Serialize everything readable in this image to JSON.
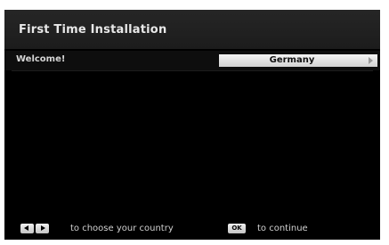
{
  "header": {
    "title": "First Time Installation"
  },
  "settings_row": {
    "label": "Welcome!",
    "country_value": "Germany"
  },
  "footer": {
    "ok_key_label": "OK",
    "choose_hint": "to choose your country",
    "continue_hint": "to continue"
  },
  "colors": {
    "background": "#000000",
    "header_bg": "#262626",
    "selector_bg": "#f4f4f4",
    "text": "#e8e8e8"
  }
}
